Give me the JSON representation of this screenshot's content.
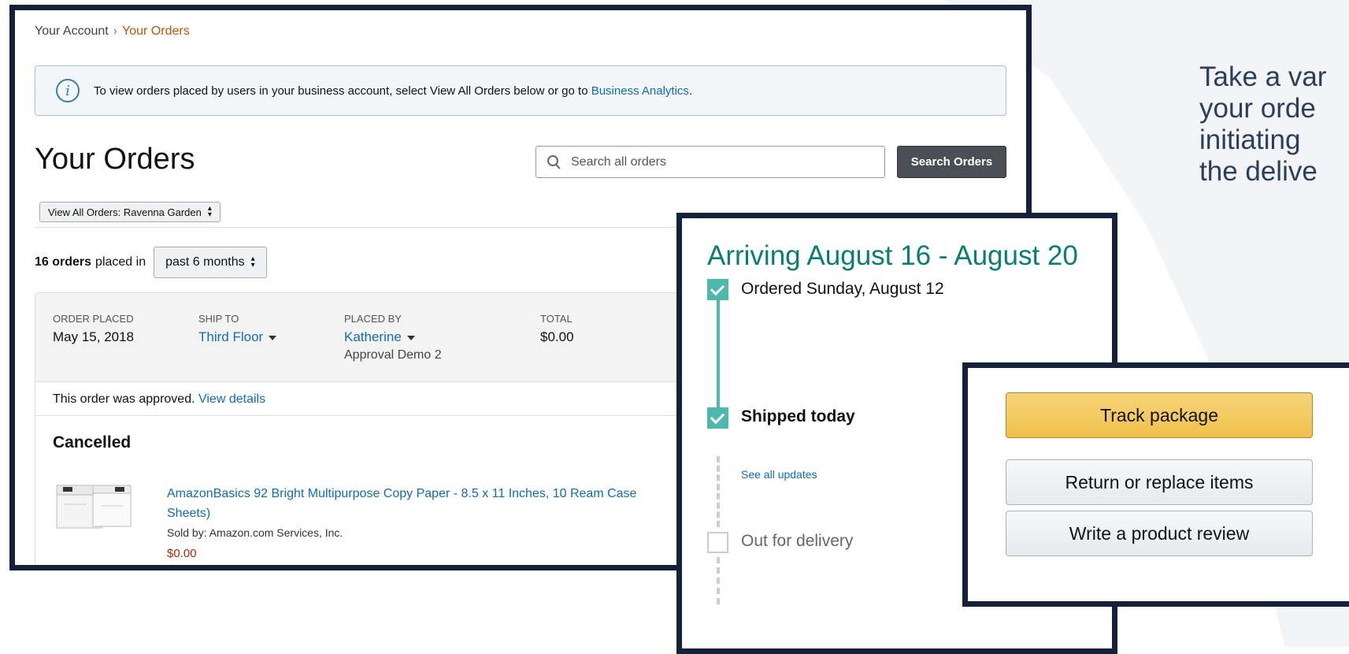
{
  "side_text": "Take a var\nyour orde\ninitiating \nthe delive",
  "breadcrumb": {
    "parent": "Your Account",
    "separator": "›",
    "current": "Your Orders"
  },
  "info_box": {
    "icon": "info-icon",
    "text": "To view orders placed by users in your business account, select View All Orders below or go to ",
    "link": "Business Analytics",
    "suffix": "."
  },
  "page_title": "Your Orders",
  "search": {
    "placeholder": "Search all orders",
    "button_label": "Search Orders",
    "icon": "search-icon"
  },
  "view_all_select": "View All Orders: Ravenna Garden",
  "orders_count": {
    "bold": "16 orders",
    "text": "placed in",
    "period": "past 6 months"
  },
  "order": {
    "columns": [
      {
        "header": "ORDER PLACED",
        "value": "May 15, 2018"
      },
      {
        "header": "SHIP TO",
        "value": "Third Floor"
      },
      {
        "header": "PLACED BY",
        "value": "Katherine",
        "sub": "Approval Demo 2"
      },
      {
        "header": "TOTAL",
        "value": "$0.00"
      }
    ],
    "approved_text": "This order was approved.",
    "approved_link": "View details",
    "status": "Cancelled",
    "product": {
      "title": "AmazonBasics 92 Bright Multipurpose Copy Paper - 8.5 x 11 Inches, 10 Ream Case",
      "title_line2": "Sheets)",
      "sold_by": "Sold by: Amazon.com Services, Inc.",
      "price": "$0.00"
    }
  },
  "tracking": {
    "arriving": "Arriving August 16 - August 20",
    "steps": [
      {
        "label": "Ordered Sunday, August 12",
        "state": "done"
      },
      {
        "label": "Shipped today",
        "state": "done",
        "link": "See all updates"
      },
      {
        "label": "Out for delivery",
        "state": "pending"
      }
    ],
    "accent_color": "#087f73"
  },
  "actions": {
    "track": "Track package",
    "return": "Return or replace items",
    "review": "Write a product review"
  }
}
